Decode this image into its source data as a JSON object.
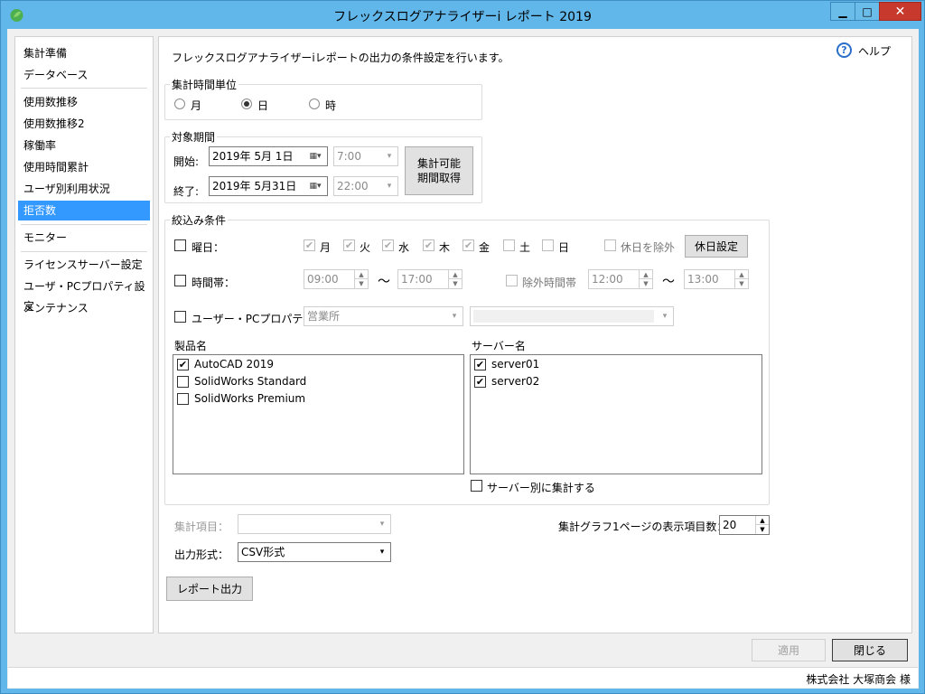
{
  "window": {
    "title": "フレックスログアナライザーi レポート 2019"
  },
  "titlebar": {
    "min_glyph": "▁",
    "max_glyph": "□",
    "close_glyph": "✕"
  },
  "sidebar": {
    "items": [
      {
        "label": "集計準備"
      },
      {
        "label": "データベース"
      },
      {
        "label": "使用数推移"
      },
      {
        "label": "使用数推移2"
      },
      {
        "label": "稼働率"
      },
      {
        "label": "使用時間累計"
      },
      {
        "label": "ユーザ別利用状況"
      },
      {
        "label": "拒否数"
      },
      {
        "label": "モニター"
      },
      {
        "label": "ライセンスサーバー設定"
      },
      {
        "label": "ユーザ・PCプロパティ設定"
      },
      {
        "label": "メンテナンス"
      }
    ],
    "selected": "拒否数"
  },
  "main": {
    "description": "フレックスログアナライザーiレポートの出力の条件設定を行います。",
    "help": {
      "icon": "help-icon",
      "glyph": "?",
      "label": "ヘルプ"
    },
    "time_unit": {
      "title": "集計時間単位",
      "options": [
        "月",
        "日",
        "時"
      ],
      "selected": "日"
    },
    "period": {
      "title": "対象期間",
      "start_label": "開始:",
      "start_date": "2019年  5月  1日",
      "start_time": "7:00",
      "end_label": "終了:",
      "end_date": "2019年  5月31日",
      "end_time": "22:00",
      "get_button": "集計可能\n期間取得"
    },
    "filter": {
      "title": "絞込み条件",
      "weekday_label": "曜日：",
      "weekdays": [
        {
          "label": "月",
          "checked": true
        },
        {
          "label": "火",
          "checked": true
        },
        {
          "label": "水",
          "checked": true
        },
        {
          "label": "木",
          "checked": true
        },
        {
          "label": "金",
          "checked": true
        },
        {
          "label": "土",
          "checked": false
        },
        {
          "label": "日",
          "checked": false
        }
      ],
      "exclude_holiday_label": "休日を除外",
      "holiday_button": "休日設定",
      "time_range_label": "時間帯：",
      "time_from": "09:00",
      "time_to": "17:00",
      "tilde": "～",
      "exclude_time_label": "除外時間帯",
      "exclude_from": "12:00",
      "exclude_to": "13:00",
      "property_label": "ユーザー・PCプロパティ：",
      "property_value": "営業所",
      "property_value2": "",
      "product_header": "製品名",
      "products": [
        {
          "label": "AutoCAD 2019",
          "checked": true
        },
        {
          "label": "SolidWorks Standard",
          "checked": false
        },
        {
          "label": "SolidWorks Premium",
          "checked": false
        }
      ],
      "server_header": "サーバー名",
      "servers": [
        {
          "label": "server01",
          "checked": true
        },
        {
          "label": "server02",
          "checked": true
        }
      ],
      "per_server_label": "サーバー別に集計する"
    },
    "agg_item_label": "集計項目：",
    "agg_item_value": "",
    "output_label": "出力形式：",
    "output_value": "CSV形式",
    "graph_items_label": "集計グラフ1ページの表示項目数：",
    "graph_items_value": "20",
    "report_button": "レポート出力"
  },
  "footer": {
    "apply_button": "適用",
    "close_button": "閉じる",
    "status_text": "株式会社 大塚商会 様"
  },
  "colors": {
    "selection": "#3399ff",
    "titlebar": "#61b7ea",
    "close": "#c7392c"
  }
}
